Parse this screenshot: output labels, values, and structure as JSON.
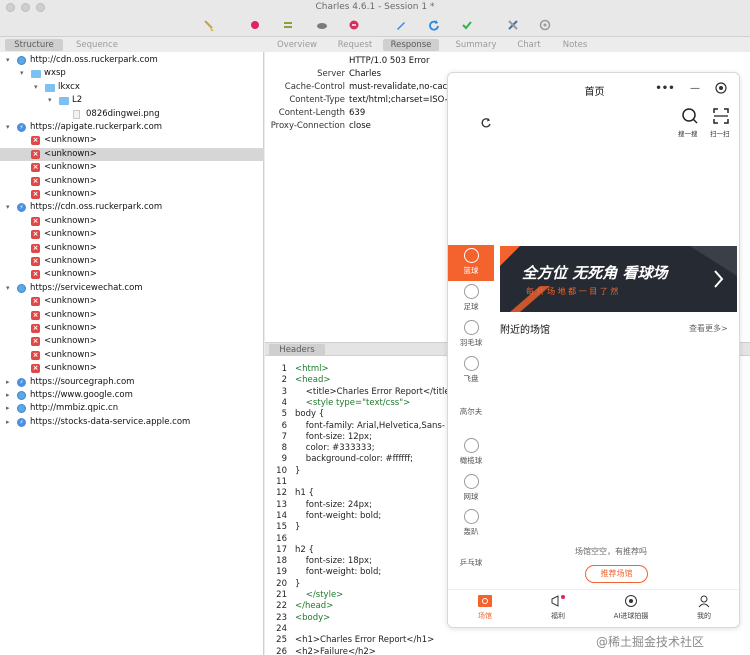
{
  "window": {
    "title": "Charles 4.6.1 - Session 1 *"
  },
  "left_tabs": [
    "Structure",
    "Sequence"
  ],
  "right_tabs": [
    "Overview",
    "Request",
    "Response",
    "Summary",
    "Chart",
    "Notes"
  ],
  "tree": [
    {
      "kind": "globe",
      "indent": 0,
      "open": true,
      "label": "http://cdn.oss.ruckerpark.com"
    },
    {
      "kind": "folder",
      "indent": 1,
      "open": true,
      "label": "wxsp"
    },
    {
      "kind": "folder",
      "indent": 2,
      "open": true,
      "label": "lkxcx"
    },
    {
      "kind": "folder",
      "indent": 3,
      "open": true,
      "label": "L2"
    },
    {
      "kind": "doc",
      "indent": 4,
      "open": null,
      "label": "0826dingwei.png"
    },
    {
      "kind": "bolt",
      "indent": 0,
      "open": true,
      "label": "https://apigate.ruckerpark.com"
    },
    {
      "kind": "err",
      "indent": 1,
      "open": null,
      "label": "<unknown>"
    },
    {
      "kind": "err",
      "indent": 1,
      "open": null,
      "label": "<unknown>",
      "selected": true
    },
    {
      "kind": "err",
      "indent": 1,
      "open": null,
      "label": "<unknown>"
    },
    {
      "kind": "err",
      "indent": 1,
      "open": null,
      "label": "<unknown>"
    },
    {
      "kind": "err",
      "indent": 1,
      "open": null,
      "label": "<unknown>"
    },
    {
      "kind": "bolt",
      "indent": 0,
      "open": true,
      "label": "https://cdn.oss.ruckerpark.com"
    },
    {
      "kind": "err",
      "indent": 1,
      "open": null,
      "label": "<unknown>"
    },
    {
      "kind": "err",
      "indent": 1,
      "open": null,
      "label": "<unknown>"
    },
    {
      "kind": "err",
      "indent": 1,
      "open": null,
      "label": "<unknown>"
    },
    {
      "kind": "err",
      "indent": 1,
      "open": null,
      "label": "<unknown>"
    },
    {
      "kind": "err",
      "indent": 1,
      "open": null,
      "label": "<unknown>"
    },
    {
      "kind": "globe",
      "indent": 0,
      "open": true,
      "label": "https://servicewechat.com"
    },
    {
      "kind": "err",
      "indent": 1,
      "open": null,
      "label": "<unknown>"
    },
    {
      "kind": "err",
      "indent": 1,
      "open": null,
      "label": "<unknown>"
    },
    {
      "kind": "err",
      "indent": 1,
      "open": null,
      "label": "<unknown>"
    },
    {
      "kind": "err",
      "indent": 1,
      "open": null,
      "label": "<unknown>"
    },
    {
      "kind": "err",
      "indent": 1,
      "open": null,
      "label": "<unknown>"
    },
    {
      "kind": "err",
      "indent": 1,
      "open": null,
      "label": "<unknown>"
    },
    {
      "kind": "bolt",
      "indent": 0,
      "open": false,
      "label": "https://sourcegraph.com"
    },
    {
      "kind": "globe",
      "indent": 0,
      "open": false,
      "label": "https://www.google.com"
    },
    {
      "kind": "globe",
      "indent": 0,
      "open": false,
      "label": "http://mmbiz.qpic.cn"
    },
    {
      "kind": "bolt",
      "indent": 0,
      "open": false,
      "label": "https://stocks-data-service.apple.com"
    }
  ],
  "response_headers": {
    "status": "HTTP/1.0 503 Error",
    "rows": [
      {
        "key": "Server",
        "value": "Charles"
      },
      {
        "key": "Cache-Control",
        "value": "must-revalidate,no-cach"
      },
      {
        "key": "Content-Type",
        "value": "text/html;charset=ISO-88"
      },
      {
        "key": "Content-Length",
        "value": "639"
      },
      {
        "key": "Proxy-Connection",
        "value": "close"
      }
    ]
  },
  "body_section_tab": "Headers",
  "code_lines": [
    {
      "n": "1",
      "text": "<html>",
      "tag": true
    },
    {
      "n": "2",
      "text": "<head>",
      "tag": true
    },
    {
      "n": "3",
      "text": "    <title>Charles Error Report</title",
      "tag": false
    },
    {
      "n": "4",
      "text": "    <style type=\"text/css\">",
      "tag": true
    },
    {
      "n": "5",
      "text": "body {",
      "tag": false
    },
    {
      "n": "6",
      "text": "    font-family: Arial,Helvetica,Sans-",
      "tag": false
    },
    {
      "n": "7",
      "text": "    font-size: 12px;",
      "tag": false
    },
    {
      "n": "8",
      "text": "    color: #333333;",
      "tag": false
    },
    {
      "n": "9",
      "text": "    background-color: #ffffff;",
      "tag": false
    },
    {
      "n": "10",
      "text": "}",
      "tag": false
    },
    {
      "n": "11",
      "text": "",
      "tag": false
    },
    {
      "n": "12",
      "text": "h1 {",
      "tag": false
    },
    {
      "n": "13",
      "text": "    font-size: 24px;",
      "tag": false
    },
    {
      "n": "14",
      "text": "    font-weight: bold;",
      "tag": false
    },
    {
      "n": "15",
      "text": "}",
      "tag": false
    },
    {
      "n": "16",
      "text": "",
      "tag": false
    },
    {
      "n": "17",
      "text": "h2 {",
      "tag": false
    },
    {
      "n": "18",
      "text": "    font-size: 18px;",
      "tag": false
    },
    {
      "n": "19",
      "text": "    font-weight: bold;",
      "tag": false
    },
    {
      "n": "20",
      "text": "}",
      "tag": false
    },
    {
      "n": "21",
      "text": "    </style>",
      "tag": true
    },
    {
      "n": "22",
      "text": "</head>",
      "tag": true
    },
    {
      "n": "23",
      "text": "<body>",
      "tag": true
    },
    {
      "n": "24",
      "text": "",
      "tag": false
    },
    {
      "n": "25",
      "text": "<h1>Charles Error Report</h1>",
      "tag": false
    },
    {
      "n": "26",
      "text": "<h2>Failure</h2>",
      "tag": false
    }
  ],
  "phone": {
    "title": "首页",
    "search_label": "搜一搜",
    "scan_label": "扫一扫",
    "categories": [
      "篮球",
      "足球",
      "羽毛球",
      "飞盘",
      "高尔夫",
      "橄榄球",
      "网球",
      "轰趴",
      "乒乓球"
    ],
    "active_category": 0,
    "banner_main": "全方位 无死角 看球场",
    "banner_sub": "每 片 场 地 都 一 目 了 然",
    "section_title": "附近的场馆",
    "section_more": "查看更多>",
    "empty_text": "场馆空空，有推荐吗",
    "recommend_button": "推荐场馆",
    "bottom_nav": [
      "场馆",
      "福利",
      "AI进球拍摄",
      "我的"
    ],
    "active_nav": 0,
    "accent": "#f4622d"
  },
  "watermark": "@稀土掘金技术社区"
}
